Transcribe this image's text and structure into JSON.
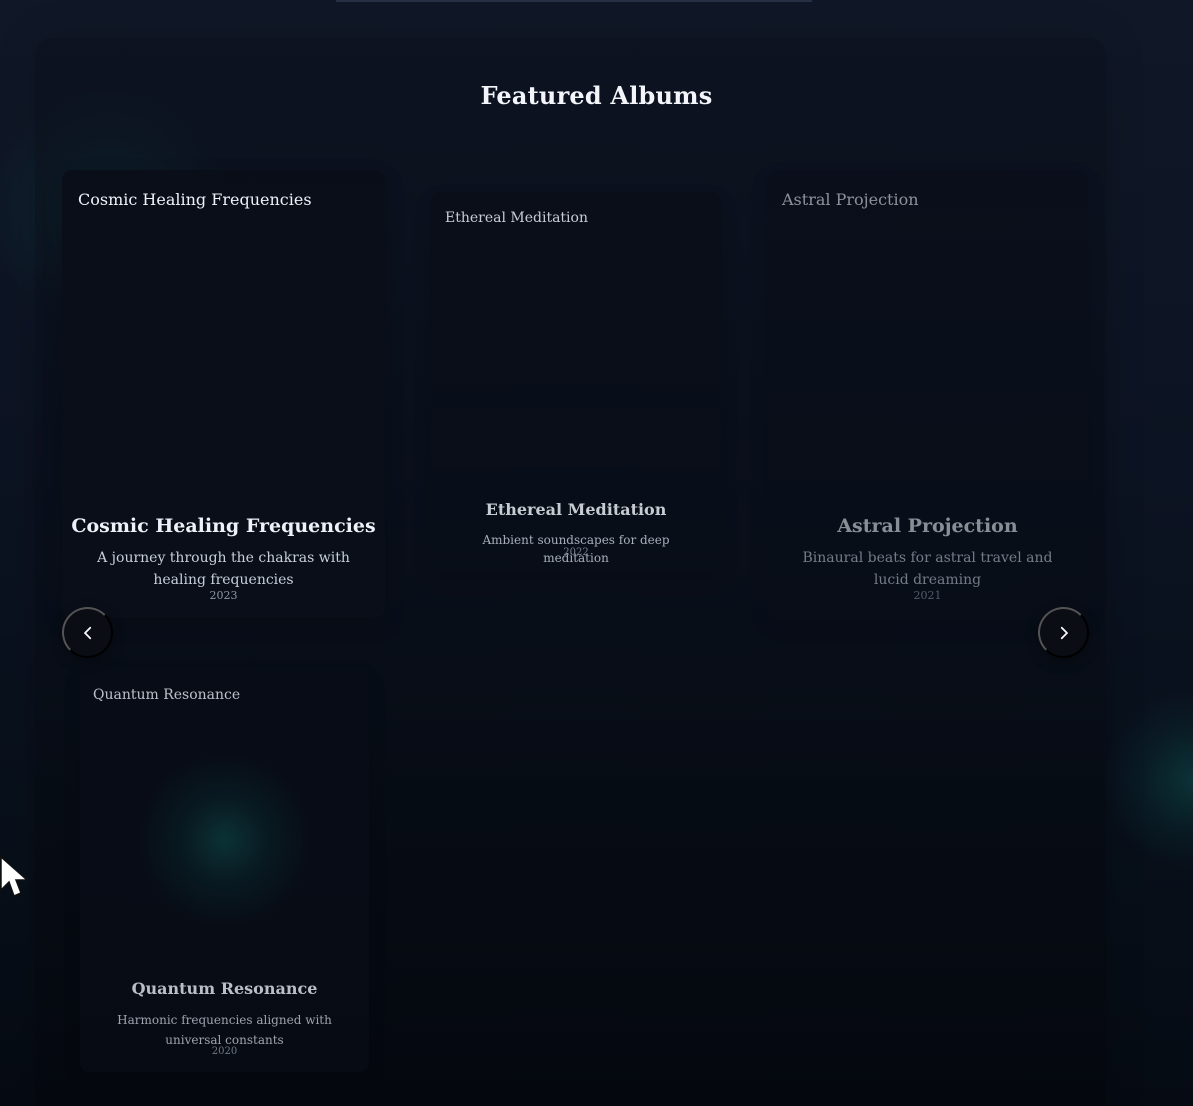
{
  "section": {
    "title": "Featured Albums"
  },
  "albums": [
    {
      "cover_text": "Cosmic Healing Frequencies",
      "title": "Cosmic Healing Frequencies",
      "description": "A journey through the chakras with healing frequencies",
      "year": "2023"
    },
    {
      "cover_text": "Ethereal Meditation",
      "title": "Ethereal Meditation",
      "description": "Ambient soundscapes for deep meditation",
      "year": "2022"
    },
    {
      "cover_text": "Astral Projection",
      "title": "Astral Projection",
      "description": "Binaural beats for astral travel and lucid dreaming",
      "year": "2021"
    },
    {
      "cover_text": "Quantum Resonance",
      "title": "Quantum Resonance",
      "description": "Harmonic frequencies aligned with universal constants",
      "year": "2020"
    }
  ],
  "navigation": {
    "previous_icon": "chevron-left-icon",
    "next_icon": "chevron-right-icon"
  },
  "theme": {
    "background": "#0b1120",
    "teal_glow": "#12736e",
    "text": "#f3f5fb"
  }
}
